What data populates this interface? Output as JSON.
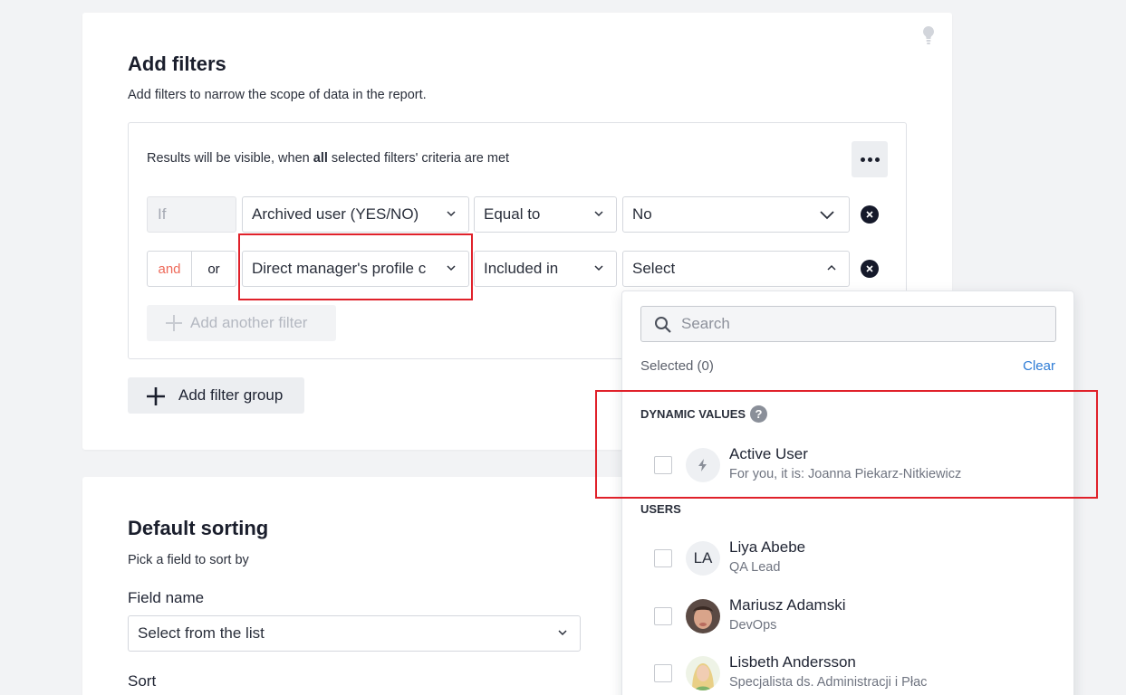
{
  "filters": {
    "title": "Add filters",
    "subtitle": "Add filters to narrow the scope of data in the report.",
    "group_text_pre": "Results will be visible, when ",
    "group_text_bold": "all",
    "group_text_post": " selected filters' criteria are met",
    "rows": [
      {
        "connector": "If",
        "field": "Archived user (YES/NO)",
        "operator": "Equal to",
        "value": "No"
      },
      {
        "connector_and": "and",
        "connector_or": "or",
        "field": "Direct manager's profile c",
        "operator": "Included in",
        "value": "Select"
      }
    ],
    "add_filter_label": "Add another filter",
    "add_group_label": "Add filter group"
  },
  "sorting": {
    "title": "Default sorting",
    "subtitle": "Pick a field to sort by",
    "field_name_label": "Field name",
    "field_placeholder": "Select from the list",
    "sort_label": "Sort"
  },
  "dropdown": {
    "search_placeholder": "Search",
    "selected_label": "Selected (0)",
    "clear_label": "Clear",
    "dynamic_heading": "DYNAMIC VALUES",
    "help_glyph": "?",
    "dynamic_items": [
      {
        "name": "Active User",
        "desc": "For you, it is: Joanna Piekarz-Nitkiewicz"
      }
    ],
    "users_heading": "USERS",
    "users": [
      {
        "initials": "LA",
        "name": "Liya Abebe",
        "role": "QA Lead"
      },
      {
        "initials": "",
        "name": "Mariusz Adamski",
        "role": "DevOps"
      },
      {
        "initials": "",
        "name": "Lisbeth Andersson",
        "role": "Specjalista ds. Administracji i Płac"
      }
    ]
  },
  "colors": {
    "accent_red": "#ee6a5a",
    "link_blue": "#2e7cd6",
    "highlight_border": "#e0212a"
  }
}
